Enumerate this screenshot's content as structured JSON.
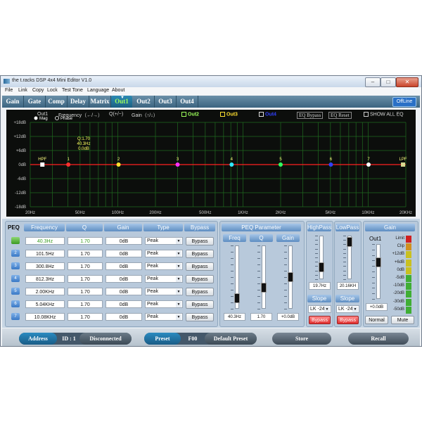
{
  "window": {
    "title": "the t.racks DSP 4x4 Mini Editor V1.0",
    "min": "–",
    "max": "□",
    "close": "✕"
  },
  "menu": [
    "File",
    "Link",
    "Copy",
    "Lock",
    "Test Tone",
    "Language",
    "About"
  ],
  "tabs": [
    "Gain",
    "Gate",
    "Comp",
    "Delay",
    "Matrix",
    "Out1",
    "Out2",
    "Out3",
    "Out4"
  ],
  "active_tab": "Out1",
  "tab_marker": "▼",
  "offline": "OffLine",
  "graph_header": {
    "channel": "Out1",
    "frequency": "Frequency（←/→）",
    "q": "Q(+/−)",
    "gain": "Gain（↑/↓）",
    "out2": "Out2",
    "out3": "Out3",
    "out4": "Out4",
    "eq_bypass": "EQ Bypass",
    "eq_reset": "EQ Reset",
    "show_all": "SHOW ALL EQ"
  },
  "graph": {
    "mag": "Mag",
    "phase": "Phase",
    "y_labels": [
      "+18dB",
      "+12dB",
      "+6dB",
      "0dB",
      "-6dB",
      "-12dB",
      "-18dB"
    ],
    "x_labels": [
      "20Hz",
      "50Hz",
      "100Hz",
      "200Hz",
      "500Hz",
      "1KHz",
      "2KHz",
      "5KHz",
      "10KHz",
      "20KHz"
    ],
    "tooltip": [
      "Q:1.70",
      "40.3Hz",
      "0.0dB"
    ],
    "nodes": [
      {
        "label": "HPF",
        "color": "#ffffff",
        "freq": "20Hz"
      },
      {
        "label": "1",
        "color": "#ff3030",
        "freq": "40.3Hz"
      },
      {
        "label": "2",
        "color": "#ffe030",
        "freq": "101.5Hz"
      },
      {
        "label": "3",
        "color": "#ff30ff",
        "freq": "300.8Hz"
      },
      {
        "label": "4",
        "color": "#30e8ff",
        "freq": "812.3Hz"
      },
      {
        "label": "5",
        "color": "#30ff60",
        "freq": "2.00KHz"
      },
      {
        "label": "6",
        "color": "#3040ff",
        "freq": "5.04KHz"
      },
      {
        "label": "7",
        "color": "#ffffff",
        "freq": "10.08KHz"
      },
      {
        "label": "LPF",
        "color": "#d8d890",
        "freq": "20.16KHz"
      }
    ]
  },
  "peq": {
    "headers": [
      "PEQ",
      "Frequency",
      "Q",
      "Gain",
      "Type",
      "Bypass"
    ],
    "rows": [
      {
        "n": "1",
        "freq": "40.3Hz",
        "q": "1.70",
        "gain": "0dB",
        "type": "Peak",
        "bypass": "Bypass"
      },
      {
        "n": "2",
        "freq": "101.5Hz",
        "q": "1.70",
        "gain": "0dB",
        "type": "Peak",
        "bypass": "Bypass"
      },
      {
        "n": "3",
        "freq": "300.8Hz",
        "q": "1.70",
        "gain": "0dB",
        "type": "Peak",
        "bypass": "Bypass"
      },
      {
        "n": "4",
        "freq": "812.3Hz",
        "q": "1.70",
        "gain": "0dB",
        "type": "Peak",
        "bypass": "Bypass"
      },
      {
        "n": "5",
        "freq": "2.00KHz",
        "q": "1.70",
        "gain": "0dB",
        "type": "Peak",
        "bypass": "Bypass"
      },
      {
        "n": "6",
        "freq": "5.04KHz",
        "q": "1.70",
        "gain": "0dB",
        "type": "Peak",
        "bypass": "Bypass"
      },
      {
        "n": "7",
        "freq": "10.08KHz",
        "q": "1.70",
        "gain": "0dB",
        "type": "Peak",
        "bypass": "Bypass"
      }
    ]
  },
  "peq_param": {
    "title": "PEQ Parameter",
    "freq_label": "Freq",
    "q_label": "Q",
    "gain_label": "Gain",
    "freq_val": "40.3Hz",
    "q_val": "1.70",
    "gain_val": "+0.0dB",
    "freq_level": 0.1,
    "q_level": 0.3,
    "gain_level": 0.5
  },
  "highpass": {
    "title": "HighPass",
    "val": "19.7Hz",
    "level": 0.2,
    "slope": "Slope",
    "slope_val": "LK -24",
    "bypass": "Bypass"
  },
  "lowpass": {
    "title": "LowPass",
    "val": "20.16KH",
    "level": 0.95,
    "slope": "Slope",
    "slope_val": "LK -24",
    "bypass": "Bypass"
  },
  "gain_panel": {
    "title": "Gain",
    "channel": "Out1",
    "val": "+0.0dB",
    "level": 0.7,
    "normal": "Normal",
    "mute": "Mute",
    "meter_labels": [
      "Limit",
      "Clip",
      "+12dB",
      "+6dB",
      "0dB",
      "-5dB",
      "-10dB",
      "-20dB",
      "-30dB",
      "-50dB"
    ]
  },
  "footer": {
    "address": "Address",
    "id": "ID : 1",
    "status": "Disconnected",
    "preset": "Preset",
    "preset_no": "F00",
    "preset_name": "Default Preset",
    "store": "Store",
    "recall": "Recall"
  },
  "colors": {
    "accent_green": "#9dff5a",
    "graph_bg": "#0c0e0c",
    "grid": "#1f6b1f",
    "curve": "#ff2020",
    "panel": "#b8c9db"
  }
}
